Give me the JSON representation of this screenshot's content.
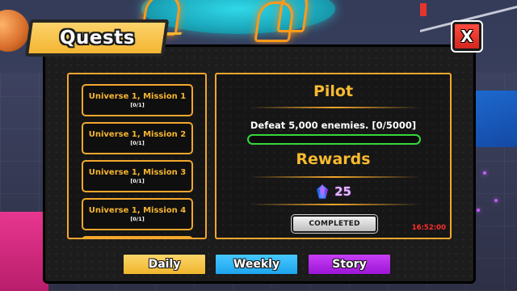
{
  "panel": {
    "title": "Quests",
    "close_label": "X"
  },
  "missions": [
    {
      "name": "Universe 1, Mission 1",
      "progress": "[0/1]"
    },
    {
      "name": "Universe 1, Mission 2",
      "progress": "[0/1]"
    },
    {
      "name": "Universe 1, Mission 3",
      "progress": "[0/1]"
    },
    {
      "name": "Universe 1, Mission 4",
      "progress": "[0/1]"
    }
  ],
  "detail": {
    "title": "Pilot",
    "description": "Defeat 5,000 enemies. [0/5000]",
    "progress_fraction": 0,
    "rewards_title": "Rewards",
    "reward_icon": "gem-icon",
    "reward_amount": "25",
    "status_button": "COMPLETED",
    "timer": "16:52:00"
  },
  "tabs": {
    "daily": "Daily",
    "weekly": "Weekly",
    "story": "Story"
  },
  "colors": {
    "accent_gold": "#f3a72c",
    "progress_green": "#36d83a",
    "daily": "#f0b52c",
    "weekly": "#1ea4ec",
    "story": "#9b16d6",
    "close_red": "#d3261e",
    "timer_red": "#ff2b2b"
  }
}
